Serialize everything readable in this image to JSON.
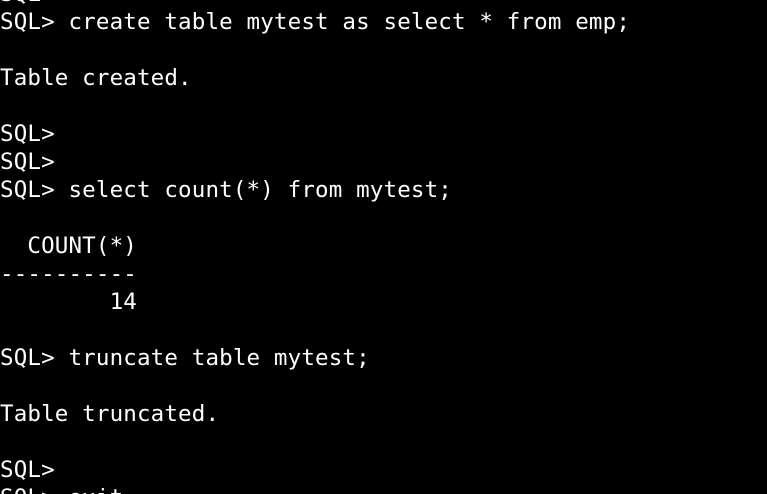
{
  "terminal": {
    "foreground": "#ffffff",
    "background": "#000000",
    "lines": [
      "SQL>",
      "SQL> create table mytest as select * from emp;",
      "",
      "Table created.",
      "",
      "SQL>",
      "SQL>",
      "SQL> select count(*) from mytest;",
      "",
      "  COUNT(*)",
      "----------",
      "        14",
      "",
      "SQL> truncate table mytest;",
      "",
      "Table truncated.",
      "",
      "SQL>",
      "SQL> exit"
    ]
  }
}
